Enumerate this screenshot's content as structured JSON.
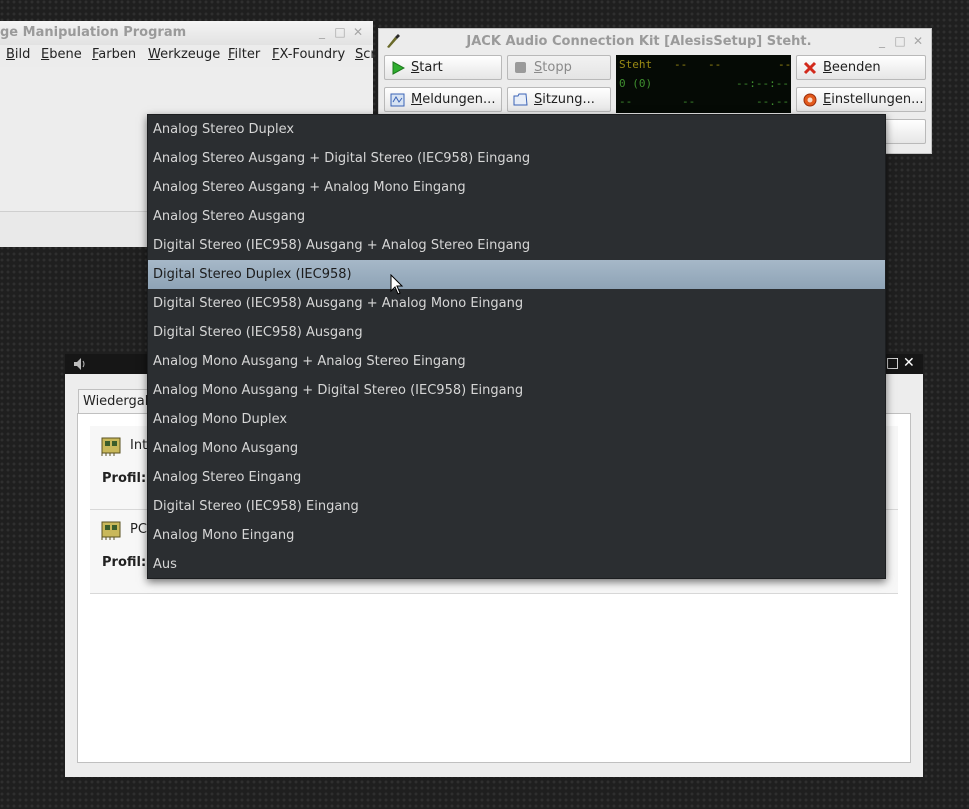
{
  "gimp": {
    "title": "ge Manipulation Program",
    "menu": [
      "Bild",
      "Ebene",
      "Farben",
      "Werkzeuge",
      "Filter",
      "FX-Foundry",
      "Scr"
    ]
  },
  "jack": {
    "title": "JACK Audio Connection Kit [AlesisSetup] Steht.",
    "buttons": {
      "start": "Start",
      "stop": "Stopp",
      "quit": "Beenden",
      "messages": "Meldungen...",
      "session": "Sitzung...",
      "settings": "Einstellungen..."
    },
    "display": {
      "status": "Steht",
      "dash1": "--",
      "dash2": "--",
      "dash3": "--",
      "xruns": "0 (0)",
      "time": "--:--:--",
      "dash4": "--",
      "dash5": "--",
      "dsp": "--.--"
    }
  },
  "pavucontrol": {
    "tab_label": "Wiedergab",
    "devices": [
      {
        "name": "Int",
        "profile_label": "Profil:"
      },
      {
        "name": "PC",
        "profile_label": "Profil:"
      }
    ]
  },
  "profile_dropdown": {
    "selected_index": 5,
    "options": [
      "Analog Stereo Duplex",
      "Analog Stereo Ausgang + Digital Stereo (IEC958) Eingang",
      "Analog Stereo Ausgang + Analog Mono Eingang",
      "Analog Stereo Ausgang",
      "Digital Stereo (IEC958) Ausgang + Analog Stereo Eingang",
      "Digital Stereo Duplex (IEC958)",
      "Digital Stereo (IEC958) Ausgang + Analog Mono Eingang",
      "Digital Stereo (IEC958) Ausgang",
      "Analog Mono Ausgang + Analog Stereo Eingang",
      "Analog Mono Ausgang + Digital Stereo (IEC958) Eingang",
      "Analog Mono Duplex",
      "Analog Mono Ausgang",
      "Analog Stereo Eingang",
      "Digital Stereo (IEC958) Eingang",
      "Analog Mono Eingang",
      "Aus"
    ]
  },
  "colors": {
    "popup_bg": "#2b2e31",
    "selected_bg": "#9fb2c3",
    "jack_display_green": "#3f8f2f"
  }
}
